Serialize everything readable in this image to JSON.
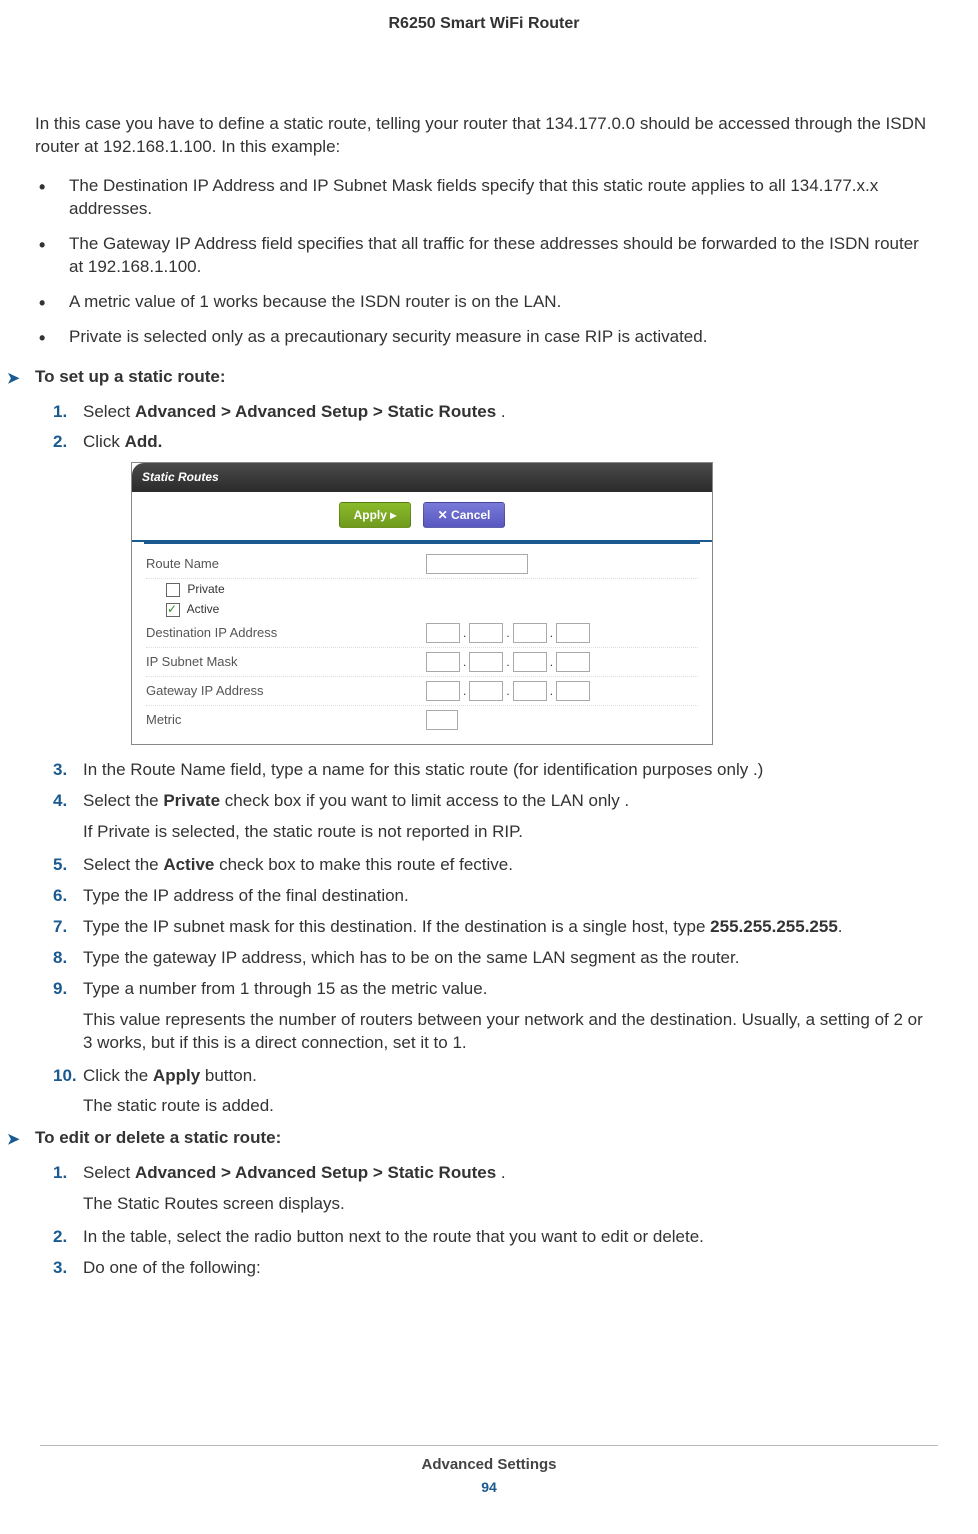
{
  "header": {
    "title": "R6250 Smart WiFi Router"
  },
  "intro": "In this case you have to define a static route, telling your router that 134.177.0.0 should be accessed through the ISDN router at 192.168.1.100. In this example:",
  "bullets": [
    "The Destination IP Address and IP Subnet Mask fields specify that this static route applies to all 134.177.x.x addresses.",
    "The Gateway IP Address field specifies that all traffic for these addresses should be forwarded to the ISDN router at 192.168.1.100.",
    "A metric value of 1 works because the ISDN router is on the LAN.",
    "Private is selected only as a precautionary security measure in case RIP is activated."
  ],
  "task1": {
    "title": "To set up a static route:",
    "steps": {
      "s1_pre": "Select ",
      "s1_bold": "Advanced > Advanced Setup > Static Routes",
      "s1_post": " .",
      "s2_pre": "Click ",
      "s2_bold": "Add.",
      "s3": "In the Route Name field, type a name for this static route (for identification purposes only   .)",
      "s4_pre": "Select the ",
      "s4_bold": "Private",
      "s4_post": " check box if you want to limit access to the LAN only  .",
      "s4_sub": "If Private is selected, the static route is not reported in RIP.",
      "s5_pre": "Select the ",
      "s5_bold": "Active",
      "s5_post": " check box to make this route ef fective.",
      "s6": "Type the IP address of the final destination.",
      "s7_pre": "Type the IP subnet mask for this destination. If the destination is a single host, type ",
      "s7_bold": "255.255.255.255",
      "s7_post": ".",
      "s8": "Type the gateway IP address, which has to be on the same LAN segment as the router.",
      "s9": "Type a number from 1 through 15 as the metric value.",
      "s9_sub": "This value represents the number of routers between your network and the destination. Usually, a setting of 2 or 3 works, but if this is a direct connection, set it to 1.",
      "s10_pre": "Click the ",
      "s10_bold": "Apply",
      "s10_post": " button.",
      "s10_sub": "The static route is added."
    }
  },
  "task2": {
    "title": "To edit or delete a static route:",
    "steps": {
      "s1_pre": "Select ",
      "s1_bold": "Advanced > Advanced Setup > Static Routes",
      "s1_post": " .",
      "s1_sub": "The Static Routes screen displays.",
      "s2": "In the table, select the radio button next to the route that you want to edit or delete.",
      "s3": "Do one of the following:"
    }
  },
  "screenshot": {
    "title": "Static Routes",
    "apply": "Apply ▸",
    "cancel": "✕ Cancel",
    "route_name": "Route Name",
    "private": "Private",
    "active": "Active",
    "dest_ip": "Destination IP Address",
    "subnet": "IP Subnet Mask",
    "gateway": "Gateway IP Address",
    "metric": "Metric"
  },
  "numbers": {
    "n1": "1.",
    "n2": "2.",
    "n3": "3.",
    "n4": "4.",
    "n5": "5.",
    "n6": "6.",
    "n7": "7.",
    "n8": "8.",
    "n9": "9.",
    "n10": "10."
  },
  "footer": {
    "section": "Advanced Settings",
    "page": "94"
  }
}
